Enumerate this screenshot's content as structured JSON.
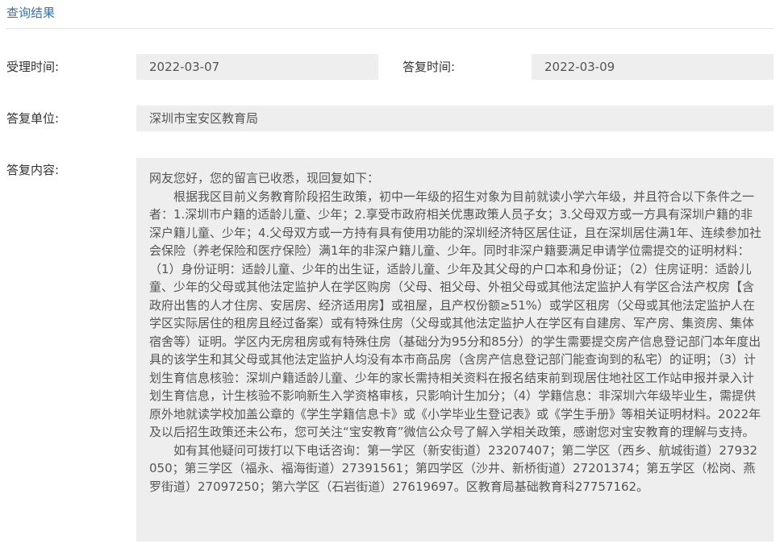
{
  "section": {
    "title": "查询结果"
  },
  "fields": {
    "accept_time_label": "受理时间:",
    "accept_time_value": "2022-03-07",
    "reply_time_label": "答复时间:",
    "reply_time_value": "2022-03-09",
    "reply_unit_label": "答复单位:",
    "reply_unit_value": "深圳市宝安区教育局",
    "reply_content_label": "答复内容:"
  },
  "reply_content": {
    "greeting": "网友您好，您的留言已收悉，现回复如下：",
    "paragraph1": "根据我区目前义务教育阶段招生政策，初中一年级的招生对象为目前就读小学六年级，并且符合以下条件之一者：1.深圳市户籍的适龄儿童、少年；2.享受市政府相关优惠政策人员子女；3.父母双方或一方具有深圳户籍的非深户籍儿童、少年；4.父母双方或一方持有具有使用功能的深圳经济特区居住证，且在深圳居住满1年、连续参加社会保险（养老保险和医疗保险）满1年的非深户籍儿童、少年。同时非深户籍要满足申请学位需提交的证明材料：（1）身份证明：适龄儿童、少年的出生证，适龄儿童、少年及其父母的户口本和身份证；（2）住房证明：适龄儿童、少年的父母或其他法定监护人在学区购房（父母、祖父母、外祖父母或其他法定监护人有学区合法产权房【含政府出售的人才住房、安居房、经济适用房】或祖屋，且产权份额≥51%）或学区租房（父母或其他法定监护人在学区实际居住的租房且经过备案）或有特殊住房（父母或其他法定监护人在学区有自建房、军产房、集资房、集体宿舍等）证明。学区内无房租房或有特殊住房（基础分为95分和85分）的学生需要提交房产信息登记部门本年度出具的该学生和其父母或其他法定监护人均没有本市商品房（含房产信息登记部门能查询到的私宅）的证明；（3）计划生育信息核验：深圳户籍适龄儿童、少年的家长需持相关资料在报名结束前到现居住地社区工作站申报并录入计划生育信息，计生核验不影响新生入学资格审核，只影响计生加分；（4）学籍信息：非深圳六年级毕业生，需提供原外地就读学校加盖公章的《学生学籍信息卡》或《小学毕业生登记表》或《学生手册》等相关证明材料。2022年及以后招生政策还未公布，您可关注“宝安教育”微信公众号了解入学相关政策，感谢您对宝安教育的理解与支持。",
    "paragraph2": "如有其他疑问可拨打以下电话咨询：第一学区（新安街道）23207407；第二学区（西乡、航城街道）27932050；第三学区（福永、福海街道）27391561；第四学区（沙井、新桥街道）27201374；第五学区（松岗、燕罗街道）27097250；第六学区（石岩街道）27619697。区教育局基础教育科27757162。"
  }
}
